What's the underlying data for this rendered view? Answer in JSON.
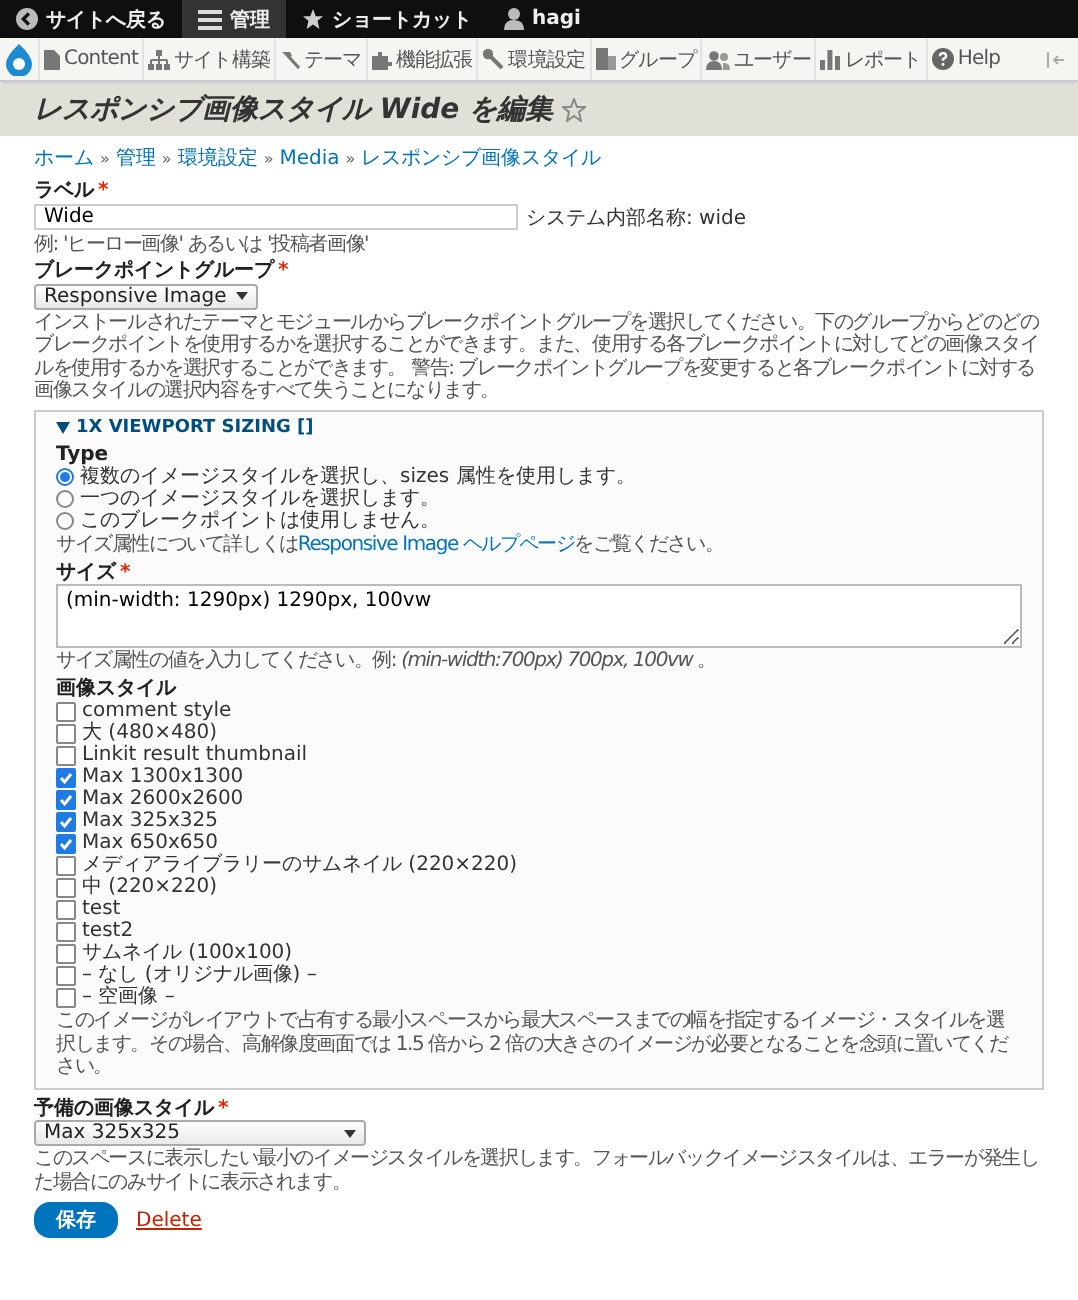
{
  "toolbar": {
    "items": [
      {
        "kind": "back",
        "label": "サイトへ戻る",
        "selected": false
      },
      {
        "kind": "menu",
        "label": "管理",
        "selected": true
      },
      {
        "kind": "star",
        "label": "ショートカット",
        "selected": false
      },
      {
        "kind": "user",
        "label": "hagi",
        "selected": false
      }
    ]
  },
  "admin_menu": [
    {
      "kind": "doc",
      "label": "Content"
    },
    {
      "kind": "tree",
      "label": "サイト構築"
    },
    {
      "kind": "hammer",
      "label": "テーマ"
    },
    {
      "kind": "puzzle",
      "label": "機能拡張"
    },
    {
      "kind": "wrench",
      "label": "環境設定"
    },
    {
      "kind": "building",
      "label": "グループ"
    },
    {
      "kind": "users",
      "label": "ユーザー"
    },
    {
      "kind": "chart",
      "label": "レポート"
    },
    {
      "kind": "help",
      "label": "Help"
    }
  ],
  "page_title": "レスポンシブ画像スタイル Wide を編集",
  "breadcrumb": {
    "separator": "»",
    "items": [
      "ホーム",
      "管理",
      "環境設定",
      "Media",
      "レスポンシブ画像スタイル"
    ]
  },
  "label_field": {
    "label": "ラベル",
    "required_mark": "*",
    "value": "Wide",
    "machine_name": "システム内部名称: wide",
    "description": "例: 'ヒーロー画像' あるいは '投稿者画像'"
  },
  "breakpoint_group": {
    "label": "ブレークポイントグループ",
    "required_mark": "*",
    "value": "Responsive Image",
    "description": "インストールされたテーマとモジュールからブレークポイントグループを選択してください。下のグループからどのどのブレークポイントを使用するかを選択することができます。また、使用する各ブレークポイントに対してどの画像スタイルを使用するかを選択することができます。 警告: ブレークポイントグループを変更すると各ブレークポイントに対する画像スタイルの選択内容をすべて失うことになります。"
  },
  "fieldset": {
    "title": "1X VIEWPORT SIZING []",
    "expanded": true,
    "type_label": "Type",
    "type_options": [
      {
        "label": "複数のイメージスタイルを選択し、sizes 属性を使用します。",
        "selected": true
      },
      {
        "label": "一つのイメージスタイルを選択します。",
        "selected": false
      },
      {
        "label": "このブレークポイントは使用しません。",
        "selected": false
      }
    ],
    "type_help": {
      "before": "サイズ属性について詳しくは",
      "link": "Responsive Image ヘルプページ",
      "after": "をご覧ください。"
    },
    "sizes": {
      "label": "サイズ",
      "required_mark": "*",
      "value": "(min-width: 1290px) 1290px, 100vw",
      "description": "サイズ属性の値を入力してください。例: *(min-width:700px) 700px, 100vw* 。"
    },
    "styles_label": "画像スタイル",
    "styles": [
      {
        "label": "comment style",
        "checked": false
      },
      {
        "label": "大 (480×480)",
        "checked": false
      },
      {
        "label": "Linkit result thumbnail",
        "checked": false
      },
      {
        "label": "Max 1300x1300",
        "checked": true
      },
      {
        "label": "Max 2600x2600",
        "checked": true
      },
      {
        "label": "Max 325x325",
        "checked": true
      },
      {
        "label": "Max 650x650",
        "checked": true
      },
      {
        "label": "メディアライブラリーのサムネイル (220×220)",
        "checked": false
      },
      {
        "label": "中 (220×220)",
        "checked": false
      },
      {
        "label": "test",
        "checked": false
      },
      {
        "label": "test2",
        "checked": false
      },
      {
        "label": "サムネイル (100x100)",
        "checked": false
      },
      {
        "label": "– なし (オリジナル画像) –",
        "checked": false
      },
      {
        "label": "– 空画像 –",
        "checked": false
      }
    ],
    "styles_description": "このイメージがレイアウトで占有する最小スペースから最大スペースまでの幅を指定するイメージ・スタイルを選択します。その場合、高解像度画面では 1.5 倍から 2 倍の大きさのイメージが必要となることを念頭に置いてください。"
  },
  "fallback": {
    "label": "予備の画像スタイル",
    "required_mark": "*",
    "value": "Max 325x325",
    "description": "このスペースに表示したい最小のイメージスタイルを選択します。フォールバックイメージスタイルは、エラーが発生した場合にのみサイトに表示されます。"
  },
  "actions": {
    "save": "保存",
    "delete": "Delete"
  }
}
